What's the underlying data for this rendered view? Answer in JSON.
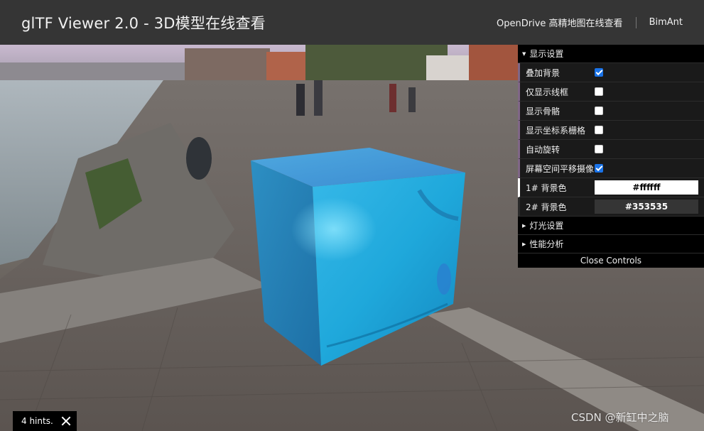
{
  "header": {
    "title": "glTF Viewer 2.0 - 3D模型在线查看",
    "links": [
      "OpenDrive 高精地图在线查看",
      "BimAnt"
    ]
  },
  "controls": {
    "display_folder": "显示设置",
    "items": [
      {
        "label": "叠加背景",
        "checked": true
      },
      {
        "label": "仅显示线框",
        "checked": false
      },
      {
        "label": "显示骨骼",
        "checked": false
      },
      {
        "label": "显示坐标系栅格",
        "checked": false
      },
      {
        "label": "自动旋转",
        "checked": false
      },
      {
        "label": "屏幕空间平移摄像",
        "checked": true
      }
    ],
    "colors": [
      {
        "label": "1# 背景色",
        "value": "#ffffff",
        "text_color": "#000000"
      },
      {
        "label": "2# 背景色",
        "value": "#353535",
        "text_color": "#ffffff"
      }
    ],
    "light_folder": "灯光设置",
    "perf_folder": "性能分析",
    "close_label": "Close Controls"
  },
  "hints": {
    "text": "4 hints."
  },
  "watermark": "CSDN @新缸中之脑",
  "icons": {
    "folder_open": "triangle-down-icon",
    "folder_closed": "triangle-right-icon",
    "close": "close-icon"
  }
}
